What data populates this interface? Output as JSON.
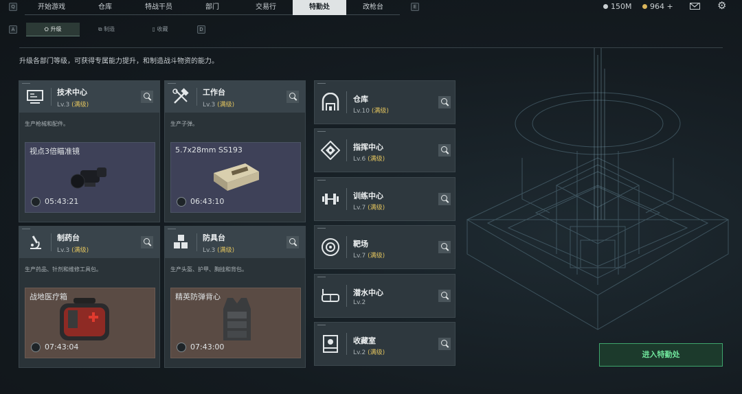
{
  "topbar": {
    "left_key": "Q",
    "right_key": "E",
    "tabs": [
      "开始游戏",
      "仓库",
      "特战干员",
      "部门",
      "交易行",
      "特勤处",
      "改枪台"
    ],
    "active_tab": 5,
    "currency1": "150M",
    "currency2": "964 +"
  },
  "subtabs": {
    "left_key": "A",
    "right_key": "D",
    "items": [
      "升级",
      "制造",
      "收藏"
    ],
    "active": 0
  },
  "description": "升级各部门等级，可获得专属能力提升，和制造战斗物资的能力。",
  "cards": [
    {
      "name": "技术中心",
      "lv": "Lv.3",
      "status": "(满级)",
      "desc": "生产枪械和配件。",
      "item": "视点3倍瞄准镜",
      "timer": "05:43:21",
      "icon": "computer-icon"
    },
    {
      "name": "工作台",
      "lv": "Lv.3",
      "status": "(满级)",
      "desc": "生产子弹。",
      "item": "5.7x28mm SS193",
      "timer": "06:43:10",
      "icon": "tools-icon"
    },
    {
      "name": "制药台",
      "lv": "Lv.3",
      "status": "(满级)",
      "desc": "生产药品、针剂和维修工具包。",
      "item": "战地医疗箱",
      "timer": "07:43:04",
      "icon": "microscope-icon"
    },
    {
      "name": "防具台",
      "lv": "Lv.3",
      "status": "(满级)",
      "desc": "生产头盔、护甲、胸挂和背包。",
      "item": "精英防弹背心",
      "timer": "07:43:00",
      "icon": "cubes-icon"
    }
  ],
  "list": [
    {
      "name": "仓库",
      "lv": "Lv.10",
      "status": "(满级)",
      "icon": "warehouse-icon"
    },
    {
      "name": "指挥中心",
      "lv": "Lv.6",
      "status": "(满级)",
      "icon": "command-icon"
    },
    {
      "name": "训练中心",
      "lv": "Lv.7",
      "status": "(满级)",
      "icon": "dumbbell-icon"
    },
    {
      "name": "靶场",
      "lv": "Lv.7",
      "status": "(满级)",
      "icon": "target-icon"
    },
    {
      "name": "潜水中心",
      "lv": "Lv.2",
      "status": "",
      "icon": "diving-mask-icon"
    },
    {
      "name": "收藏室",
      "lv": "Lv.2",
      "status": "(满级)",
      "icon": "trophy-case-icon"
    }
  ],
  "enter_button": "进入特勤处",
  "colors": {
    "accent_green": "#6fe39b",
    "gold": "#e1c35e",
    "active_tab_bg": "#dfe3e4"
  }
}
